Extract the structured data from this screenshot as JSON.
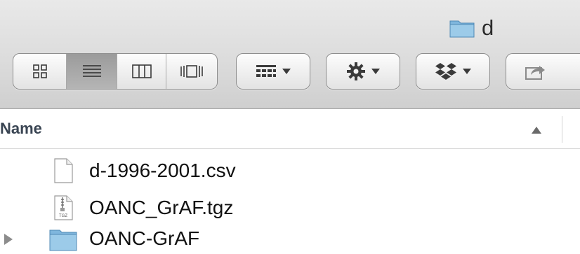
{
  "window": {
    "title": "d"
  },
  "toolbar": {
    "view_modes": [
      "icon-view",
      "list-view",
      "column-view",
      "cover-flow-view"
    ],
    "active_view": "list-view",
    "buttons": [
      "arrange-menu",
      "action-menu",
      "dropbox-menu",
      "share"
    ]
  },
  "list": {
    "column_header": "Name",
    "sort": "ascending",
    "items": [
      {
        "name": "d-1996-2001.csv",
        "kind": "document-icon"
      },
      {
        "name": "OANC_GrAF.tgz",
        "kind": "tgz-archive-icon",
        "badge": "TGZ"
      },
      {
        "name": "OANC-GrAF",
        "kind": "folder-icon"
      }
    ]
  }
}
